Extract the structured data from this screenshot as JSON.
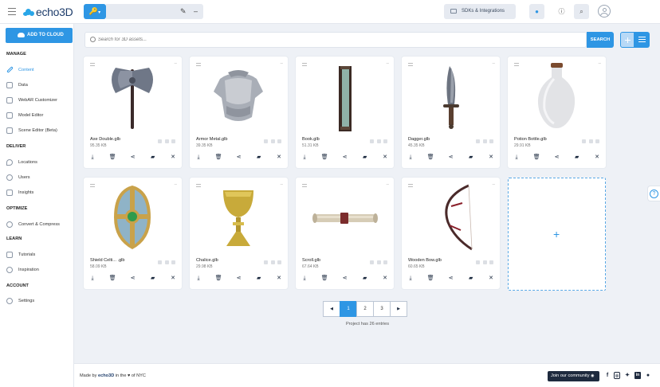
{
  "topbar": {
    "logo_text": "echo3D",
    "sdk_label": "SDKs & Integrations"
  },
  "sidebar": {
    "add_button": "ADD TO CLOUD",
    "sections": [
      {
        "title": "MANAGE",
        "items": [
          "Content",
          "Data",
          "WebAR Customizer",
          "Model Editor",
          "Scene Editor (Beta)"
        ]
      },
      {
        "title": "DELIVER",
        "items": [
          "Locations",
          "Users",
          "Insights"
        ]
      },
      {
        "title": "OPTIMIZE",
        "items": [
          "Convert & Compress"
        ]
      },
      {
        "title": "LEARN",
        "items": [
          "Tutorials",
          "Inspiration"
        ]
      },
      {
        "title": "ACCOUNT",
        "items": [
          "Settings"
        ]
      }
    ]
  },
  "search": {
    "placeholder": "Search for 3D assets...",
    "button": "SEARCH"
  },
  "assets": [
    {
      "name": "Axe Double.glb",
      "size": "95.35 KB"
    },
    {
      "name": "Armor Metal.glb",
      "size": "39.35 KB"
    },
    {
      "name": "Book.glb",
      "size": "51.31 KB"
    },
    {
      "name": "Dagger.glb",
      "size": "45.35 KB"
    },
    {
      "name": "Potion Bottle.glb",
      "size": "29.91 KB"
    },
    {
      "name": "Shield Celti... .glb",
      "size": "58.09 KB"
    },
    {
      "name": "Chalice.glb",
      "size": "29.98 KB"
    },
    {
      "name": "Scroll.glb",
      "size": "67.64 KB"
    },
    {
      "name": "Wooden Bow.glb",
      "size": "60.65 KB"
    }
  ],
  "add_card_symbol": "+",
  "pagination": {
    "prev": "◀",
    "pages": [
      "1",
      "2",
      "3"
    ],
    "next": "▶",
    "current": "1"
  },
  "entries_text": "Project has 26 entries",
  "footer": {
    "made_by_prefix": "Made by",
    "made_by_brand": "echo3D",
    "made_by_suffix": "in the ♥ of NYC",
    "community_button": "Join our community",
    "social_icons": [
      "facebook-icon",
      "instagram-icon",
      "twitter-icon",
      "linkedin-icon",
      "github-icon"
    ]
  },
  "colors": {
    "accent": "#2e96e4",
    "brand": "#1e3d6b",
    "footer_button": "#1e2a3e"
  }
}
